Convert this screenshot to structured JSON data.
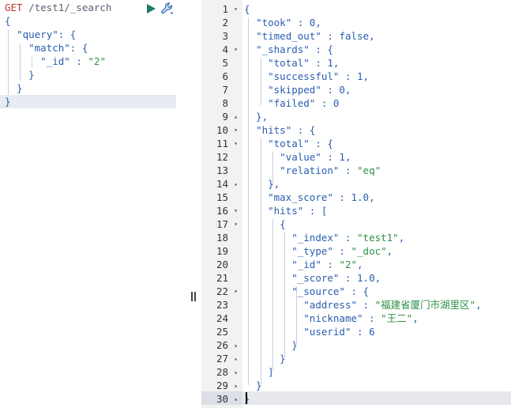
{
  "request": {
    "method": "GET",
    "path": " /test1/_search",
    "lines": [
      "{",
      "  \"query\": {",
      "    \"match\": {",
      "      \"_id\" : \"2\"",
      "    }",
      "  }",
      "}"
    ],
    "icons": [
      "play-icon",
      "wrench-icon"
    ]
  },
  "response": {
    "line_numbers": [
      "1",
      "2",
      "3",
      "4",
      "5",
      "6",
      "7",
      "8",
      "9",
      "10",
      "11",
      "12",
      "13",
      "14",
      "15",
      "16",
      "17",
      "18",
      "19",
      "20",
      "21",
      "22",
      "23",
      "24",
      "25",
      "26",
      "27",
      "28",
      "29",
      "30"
    ],
    "lines": [
      "{",
      "  \"took\" : 0,",
      "  \"timed_out\" : false,",
      "  \"_shards\" : {",
      "    \"total\" : 1,",
      "    \"successful\" : 1,",
      "    \"skipped\" : 0,",
      "    \"failed\" : 0",
      "  },",
      "  \"hits\" : {",
      "    \"total\" : {",
      "      \"value\" : 1,",
      "      \"relation\" : \"eq\"",
      "    },",
      "    \"max_score\" : 1.0,",
      "    \"hits\" : [",
      "      {",
      "        \"_index\" : \"test1\",",
      "        \"_type\" : \"_doc\",",
      "        \"_id\" : \"2\",",
      "        \"_score\" : 1.0,",
      "        \"_source\" : {",
      "          \"address\" : \"福建省厦门市湖里区\",",
      "          \"nickname\" : \"王二\",",
      "          \"userid\" : 6",
      "        }",
      "      }",
      "    ]",
      "  }",
      "}"
    ],
    "fold_markers": [
      "▾",
      "",
      "",
      "▾",
      "",
      "",
      "",
      "",
      "▴",
      "▾",
      "▾",
      "",
      "",
      "▴",
      "",
      "▾",
      "▾",
      "",
      "",
      "",
      "",
      "▾",
      "",
      "",
      "",
      "▴",
      "▴",
      "▴",
      "▴",
      "▴"
    ]
  },
  "colors": {
    "key": "#2a5db0",
    "string": "#2f8f46",
    "method": "#c0392b",
    "gutter_bg": "#f2f2f2",
    "active_line_bg": "#e6e8ec"
  }
}
